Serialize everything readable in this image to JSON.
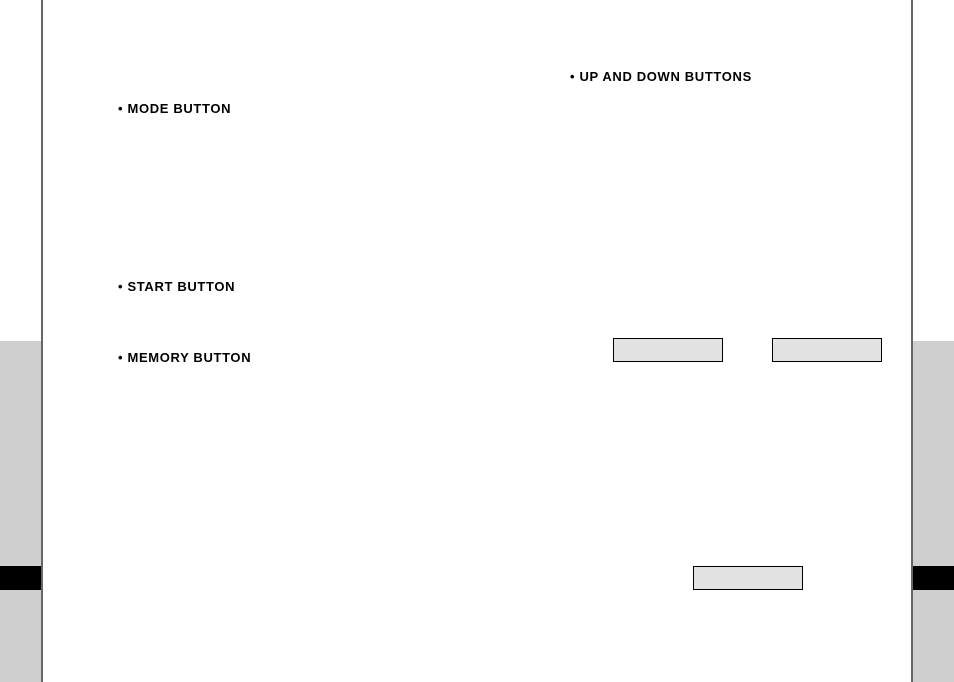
{
  "labels": {
    "mode": "MODE BUTTON",
    "start": "START BUTTON",
    "memory": "MEMORY BUTTON",
    "updown": "UP AND DOWN BUTTONS"
  }
}
